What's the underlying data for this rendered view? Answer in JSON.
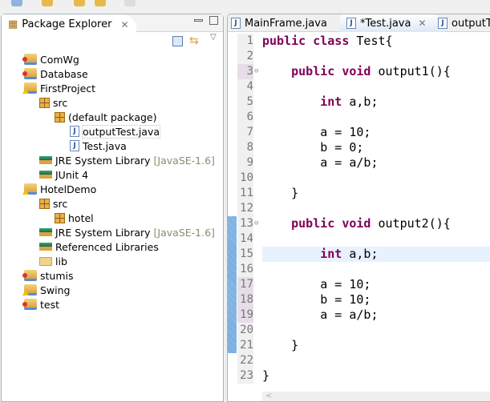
{
  "package_explorer": {
    "title": "Package Explorer",
    "tree": [
      {
        "label": "ComWg",
        "level": 0,
        "icon": "project-error-icon"
      },
      {
        "label": "Database",
        "level": 0,
        "icon": "project-error-icon"
      },
      {
        "label": "FirstProject",
        "level": 0,
        "icon": "project-warning-icon"
      },
      {
        "label": "src",
        "level": 1,
        "icon": "source-folder-icon"
      },
      {
        "label": "(default package)",
        "level": 2,
        "icon": "package-icon"
      },
      {
        "label": "outputTest.java",
        "level": 3,
        "icon": "java-file-warning-icon",
        "selected": true
      },
      {
        "label": "Test.java",
        "level": 3,
        "icon": "java-file-icon"
      },
      {
        "label": "JRE System Library",
        "suffix": "[JavaSE-1.6]",
        "level": 1,
        "icon": "library-icon"
      },
      {
        "label": "JUnit 4",
        "level": 1,
        "icon": "library-icon"
      },
      {
        "label": "HotelDemo",
        "level": 0,
        "icon": "project-warning-icon"
      },
      {
        "label": "src",
        "level": 1,
        "icon": "source-folder-icon"
      },
      {
        "label": "hotel",
        "level": 2,
        "icon": "package-icon"
      },
      {
        "label": "JRE System Library",
        "suffix": "[JavaSE-1.6]",
        "level": 1,
        "icon": "library-icon"
      },
      {
        "label": "Referenced Libraries",
        "level": 1,
        "icon": "library-icon"
      },
      {
        "label": "lib",
        "level": 1,
        "icon": "folder-icon"
      },
      {
        "label": "stumis",
        "level": 0,
        "icon": "project-error-icon"
      },
      {
        "label": "Swing",
        "level": 0,
        "icon": "project-warning-icon"
      },
      {
        "label": "test",
        "level": 0,
        "icon": "project-error-icon"
      }
    ]
  },
  "editor": {
    "tabs": [
      {
        "label": "MainFrame.java",
        "active": false
      },
      {
        "label": "*Test.java",
        "active": true
      },
      {
        "label": "outputTest.java",
        "active": false
      }
    ],
    "current_line": 15,
    "lines": [
      [
        [
          "kw",
          "public class"
        ],
        [
          "p",
          " Test{"
        ]
      ],
      [],
      [
        [
          "p",
          "    "
        ],
        [
          "kw",
          "public void"
        ],
        [
          "p",
          " output1(){"
        ]
      ],
      [],
      [
        [
          "p",
          "        "
        ],
        [
          "kw",
          "int"
        ],
        [
          "p",
          " a,b;"
        ]
      ],
      [],
      [
        [
          "p",
          "        a = 10;"
        ]
      ],
      [
        [
          "p",
          "        b = 0;"
        ]
      ],
      [
        [
          "p",
          "        a = a/b;"
        ]
      ],
      [],
      [
        [
          "p",
          "    }"
        ]
      ],
      [],
      [
        [
          "p",
          "    "
        ],
        [
          "kw",
          "public void"
        ],
        [
          "p",
          " output2(){"
        ]
      ],
      [],
      [
        [
          "p",
          "        "
        ],
        [
          "kw",
          "int"
        ],
        [
          "p",
          " a,b;"
        ]
      ],
      [],
      [
        [
          "p",
          "        a = 10;"
        ]
      ],
      [
        [
          "p",
          "        b = 10;"
        ]
      ],
      [
        [
          "p",
          "        a = a/b;"
        ]
      ],
      [],
      [
        [
          "p",
          "    }"
        ]
      ],
      [],
      [
        [
          "p",
          "}"
        ]
      ]
    ],
    "marked_lines": [
      3,
      17,
      18,
      19
    ],
    "folding_lines": [
      3,
      13
    ]
  },
  "colors": {
    "keyword": "#7f0055",
    "current_line": "#e8f2fe",
    "change_bar": "#5b9bd5"
  }
}
